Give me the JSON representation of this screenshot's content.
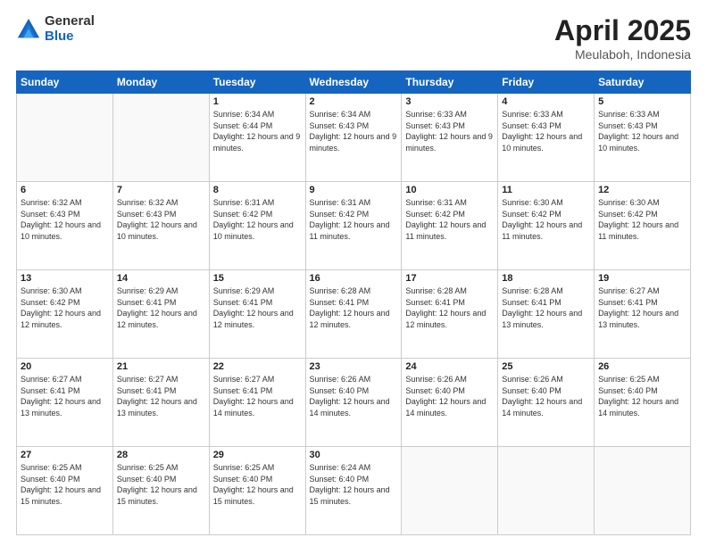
{
  "logo": {
    "general": "General",
    "blue": "Blue"
  },
  "title": {
    "month": "April 2025",
    "location": "Meulaboh, Indonesia"
  },
  "days_of_week": [
    "Sunday",
    "Monday",
    "Tuesday",
    "Wednesday",
    "Thursday",
    "Friday",
    "Saturday"
  ],
  "weeks": [
    [
      {
        "day": "",
        "sunrise": "",
        "sunset": "",
        "daylight": ""
      },
      {
        "day": "",
        "sunrise": "",
        "sunset": "",
        "daylight": ""
      },
      {
        "day": "1",
        "sunrise": "Sunrise: 6:34 AM",
        "sunset": "Sunset: 6:44 PM",
        "daylight": "Daylight: 12 hours and 9 minutes."
      },
      {
        "day": "2",
        "sunrise": "Sunrise: 6:34 AM",
        "sunset": "Sunset: 6:43 PM",
        "daylight": "Daylight: 12 hours and 9 minutes."
      },
      {
        "day": "3",
        "sunrise": "Sunrise: 6:33 AM",
        "sunset": "Sunset: 6:43 PM",
        "daylight": "Daylight: 12 hours and 9 minutes."
      },
      {
        "day": "4",
        "sunrise": "Sunrise: 6:33 AM",
        "sunset": "Sunset: 6:43 PM",
        "daylight": "Daylight: 12 hours and 10 minutes."
      },
      {
        "day": "5",
        "sunrise": "Sunrise: 6:33 AM",
        "sunset": "Sunset: 6:43 PM",
        "daylight": "Daylight: 12 hours and 10 minutes."
      }
    ],
    [
      {
        "day": "6",
        "sunrise": "Sunrise: 6:32 AM",
        "sunset": "Sunset: 6:43 PM",
        "daylight": "Daylight: 12 hours and 10 minutes."
      },
      {
        "day": "7",
        "sunrise": "Sunrise: 6:32 AM",
        "sunset": "Sunset: 6:43 PM",
        "daylight": "Daylight: 12 hours and 10 minutes."
      },
      {
        "day": "8",
        "sunrise": "Sunrise: 6:31 AM",
        "sunset": "Sunset: 6:42 PM",
        "daylight": "Daylight: 12 hours and 10 minutes."
      },
      {
        "day": "9",
        "sunrise": "Sunrise: 6:31 AM",
        "sunset": "Sunset: 6:42 PM",
        "daylight": "Daylight: 12 hours and 11 minutes."
      },
      {
        "day": "10",
        "sunrise": "Sunrise: 6:31 AM",
        "sunset": "Sunset: 6:42 PM",
        "daylight": "Daylight: 12 hours and 11 minutes."
      },
      {
        "day": "11",
        "sunrise": "Sunrise: 6:30 AM",
        "sunset": "Sunset: 6:42 PM",
        "daylight": "Daylight: 12 hours and 11 minutes."
      },
      {
        "day": "12",
        "sunrise": "Sunrise: 6:30 AM",
        "sunset": "Sunset: 6:42 PM",
        "daylight": "Daylight: 12 hours and 11 minutes."
      }
    ],
    [
      {
        "day": "13",
        "sunrise": "Sunrise: 6:30 AM",
        "sunset": "Sunset: 6:42 PM",
        "daylight": "Daylight: 12 hours and 12 minutes."
      },
      {
        "day": "14",
        "sunrise": "Sunrise: 6:29 AM",
        "sunset": "Sunset: 6:41 PM",
        "daylight": "Daylight: 12 hours and 12 minutes."
      },
      {
        "day": "15",
        "sunrise": "Sunrise: 6:29 AM",
        "sunset": "Sunset: 6:41 PM",
        "daylight": "Daylight: 12 hours and 12 minutes."
      },
      {
        "day": "16",
        "sunrise": "Sunrise: 6:28 AM",
        "sunset": "Sunset: 6:41 PM",
        "daylight": "Daylight: 12 hours and 12 minutes."
      },
      {
        "day": "17",
        "sunrise": "Sunrise: 6:28 AM",
        "sunset": "Sunset: 6:41 PM",
        "daylight": "Daylight: 12 hours and 12 minutes."
      },
      {
        "day": "18",
        "sunrise": "Sunrise: 6:28 AM",
        "sunset": "Sunset: 6:41 PM",
        "daylight": "Daylight: 12 hours and 13 minutes."
      },
      {
        "day": "19",
        "sunrise": "Sunrise: 6:27 AM",
        "sunset": "Sunset: 6:41 PM",
        "daylight": "Daylight: 12 hours and 13 minutes."
      }
    ],
    [
      {
        "day": "20",
        "sunrise": "Sunrise: 6:27 AM",
        "sunset": "Sunset: 6:41 PM",
        "daylight": "Daylight: 12 hours and 13 minutes."
      },
      {
        "day": "21",
        "sunrise": "Sunrise: 6:27 AM",
        "sunset": "Sunset: 6:41 PM",
        "daylight": "Daylight: 12 hours and 13 minutes."
      },
      {
        "day": "22",
        "sunrise": "Sunrise: 6:27 AM",
        "sunset": "Sunset: 6:41 PM",
        "daylight": "Daylight: 12 hours and 14 minutes."
      },
      {
        "day": "23",
        "sunrise": "Sunrise: 6:26 AM",
        "sunset": "Sunset: 6:40 PM",
        "daylight": "Daylight: 12 hours and 14 minutes."
      },
      {
        "day": "24",
        "sunrise": "Sunrise: 6:26 AM",
        "sunset": "Sunset: 6:40 PM",
        "daylight": "Daylight: 12 hours and 14 minutes."
      },
      {
        "day": "25",
        "sunrise": "Sunrise: 6:26 AM",
        "sunset": "Sunset: 6:40 PM",
        "daylight": "Daylight: 12 hours and 14 minutes."
      },
      {
        "day": "26",
        "sunrise": "Sunrise: 6:25 AM",
        "sunset": "Sunset: 6:40 PM",
        "daylight": "Daylight: 12 hours and 14 minutes."
      }
    ],
    [
      {
        "day": "27",
        "sunrise": "Sunrise: 6:25 AM",
        "sunset": "Sunset: 6:40 PM",
        "daylight": "Daylight: 12 hours and 15 minutes."
      },
      {
        "day": "28",
        "sunrise": "Sunrise: 6:25 AM",
        "sunset": "Sunset: 6:40 PM",
        "daylight": "Daylight: 12 hours and 15 minutes."
      },
      {
        "day": "29",
        "sunrise": "Sunrise: 6:25 AM",
        "sunset": "Sunset: 6:40 PM",
        "daylight": "Daylight: 12 hours and 15 minutes."
      },
      {
        "day": "30",
        "sunrise": "Sunrise: 6:24 AM",
        "sunset": "Sunset: 6:40 PM",
        "daylight": "Daylight: 12 hours and 15 minutes."
      },
      {
        "day": "",
        "sunrise": "",
        "sunset": "",
        "daylight": ""
      },
      {
        "day": "",
        "sunrise": "",
        "sunset": "",
        "daylight": ""
      },
      {
        "day": "",
        "sunrise": "",
        "sunset": "",
        "daylight": ""
      }
    ]
  ]
}
